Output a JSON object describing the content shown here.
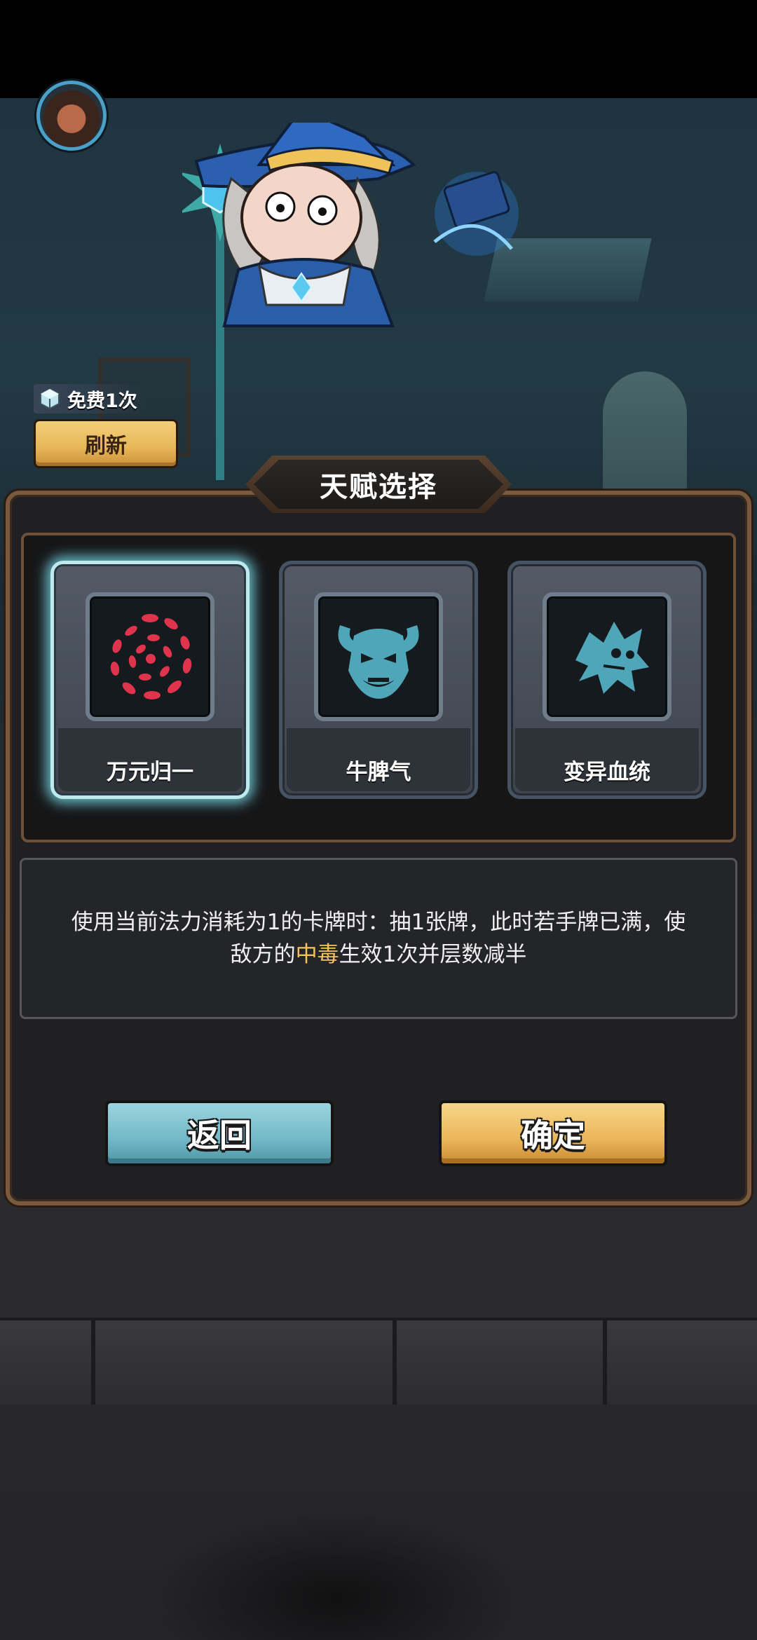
{
  "hud": {
    "free_text": "免费1次",
    "refresh_label": "刷新"
  },
  "panel": {
    "title": "天赋选择"
  },
  "talents": [
    {
      "name": "万元归一",
      "icon": "red-swirl-icon",
      "selected": true
    },
    {
      "name": "牛脾气",
      "icon": "bull-face-icon",
      "selected": false
    },
    {
      "name": "变异血统",
      "icon": "mutant-beast-icon",
      "selected": false
    }
  ],
  "description": {
    "part1": "使用当前法力消耗为1的卡牌时：抽1张牌，此时若手牌已满，使敌方的",
    "highlight": "中毒",
    "part2": "生效1次并层数减半"
  },
  "buttons": {
    "back_label": "返回",
    "confirm_label": "确定"
  },
  "colors": {
    "highlight": "#f2c65c",
    "back_button": "#72b8c6",
    "confirm_button": "#ebb65a",
    "selected_glow": "#78dceb"
  }
}
